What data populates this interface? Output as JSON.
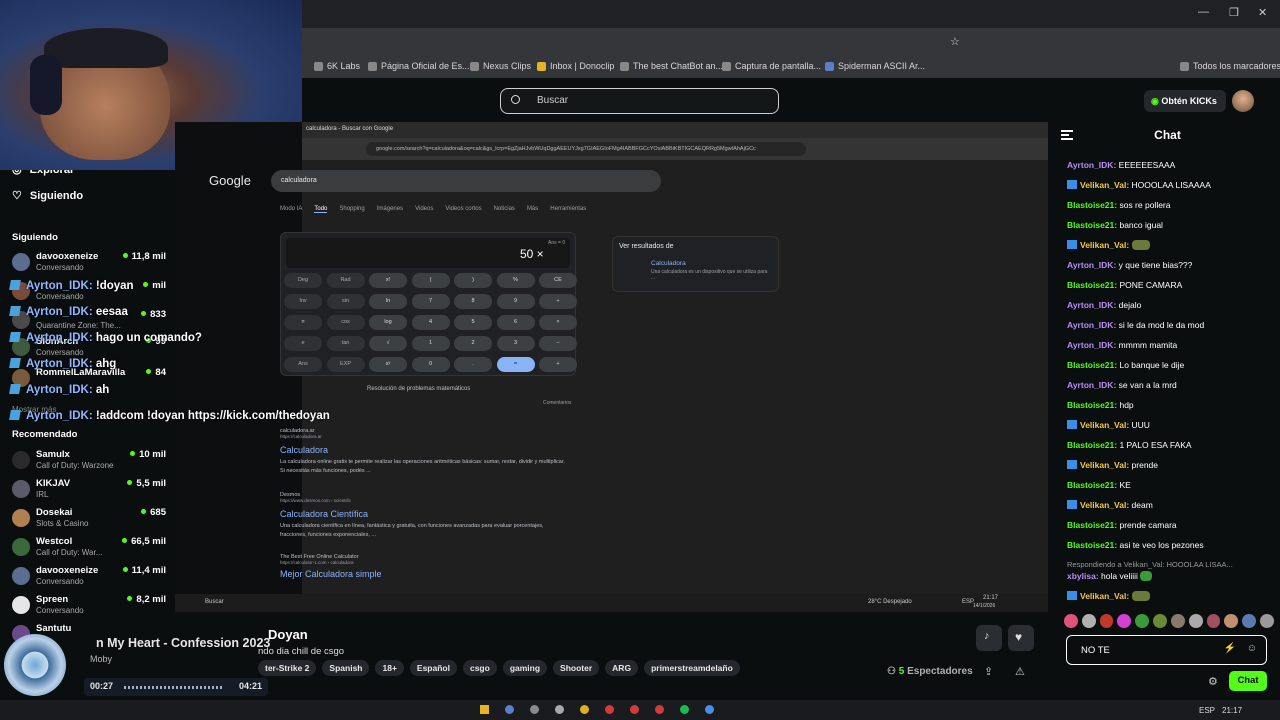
{
  "browser": {
    "bookmarks": [
      "6K Labs",
      "Página Oficial de Es...",
      "Nexus Clips",
      "Inbox | Donoclip",
      "The best ChatBot an...",
      "Captura de pantalla...",
      "Spiderman ASCII Ar..."
    ],
    "all_bookmarks": "Todos los marcadores"
  },
  "kick": {
    "search_placeholder": "Buscar",
    "get_kicks_prefix": "Obtén",
    "get_kicks_suffix": "KICKs"
  },
  "sidebar": {
    "explore": "Explorar",
    "following": "Siguiendo",
    "following_section": "Siguiendo",
    "followed": [
      {
        "name": "davooxeneize",
        "sub": "Conversando",
        "viewers": "11,8 mil",
        "color": "#5b6e8f"
      },
      {
        "name": "",
        "sub": "Conversando",
        "viewers": "mil",
        "color": "#7a4a3a"
      },
      {
        "name": "",
        "sub": "Quarantine Zone: The...",
        "viewers": "833",
        "color": "#4a4a4a"
      },
      {
        "name": "SlonArch",
        "sub": "Conversando",
        "viewers": "99",
        "color": "#3f5a3f"
      },
      {
        "name": "RommelLaMaravilla",
        "sub": "",
        "viewers": "84",
        "color": "#7a5a3a"
      }
    ],
    "show_more": "Mostrar más",
    "recommended_section": "Recomendado",
    "recommended": [
      {
        "name": "Samulx",
        "sub": "Call of Duty: Warzone",
        "viewers": "10 mil",
        "color": "#2a2a2a"
      },
      {
        "name": "KIKJAV",
        "sub": "IRL",
        "viewers": "5,5 mil",
        "color": "#5a5a6a"
      },
      {
        "name": "Dosekai",
        "sub": "Slots & Casino",
        "viewers": "685",
        "color": "#b08050"
      },
      {
        "name": "Westcol",
        "sub": "Call of Duty: War...",
        "viewers": "66,5 mil",
        "color": "#3a6a3a"
      },
      {
        "name": "davooxeneize",
        "sub": "Conversando",
        "viewers": "11,4 mil",
        "color": "#5b6e8f"
      },
      {
        "name": "Spreen",
        "sub": "Conversando",
        "viewers": "8,2 mil",
        "color": "#e6e6e6"
      },
      {
        "name": "Santutu",
        "sub": "",
        "viewers": "",
        "color": "#6a4a8a"
      }
    ]
  },
  "overlay_chat": [
    {
      "user": "Ayrton_IDK:",
      "text": "!doyan"
    },
    {
      "user": "Ayrton_IDK:",
      "text": "eesaa"
    },
    {
      "user": "Ayrton_IDK:",
      "text": "hago un comando?"
    },
    {
      "user": "Ayrton_IDK:",
      "text": "ahg"
    },
    {
      "user": "Ayrton_IDK:",
      "text": "ah"
    },
    {
      "user": "Ayrton_IDK:",
      "text": "!addcom !doyan https://kick.com/thedoyan"
    }
  ],
  "inner_browser": {
    "tab": "calculadora - Buscar con Google",
    "url": "google.com/search?q=calculadora&oq=calc&gs_lcrp=EgZjaHJvbWUqDggAEEUYJxg7GIAEGIoFMg4IABBFGCcYOxiABBiKBTIGCAEQRRg5MgwIAhAjGCc",
    "logo": "Google",
    "query": "calculadora",
    "tabs": [
      "Modo IA",
      "Todo",
      "Shopping",
      "Imágenes",
      "Videos",
      "Videos cortos",
      "Noticias",
      "Más",
      "Herramientas"
    ],
    "calc_value": "50 ×",
    "calc_ans": "Ans = 0",
    "keys": [
      [
        "Deg",
        "Rad",
        "x!",
        "(",
        ")",
        "%",
        "CE"
      ],
      [
        "Inv",
        "sin",
        "ln",
        "7",
        "8",
        "9",
        "÷"
      ],
      [
        "π",
        "cos",
        "log",
        "4",
        "5",
        "6",
        "×"
      ],
      [
        "e",
        "tan",
        "√",
        "1",
        "2",
        "3",
        "−"
      ],
      [
        "Ans",
        "EXP",
        "xʸ",
        "0",
        ".",
        "=",
        "+"
      ]
    ],
    "math_help": "Resolución de problemas matemáticos",
    "comments": "Comentarios",
    "panel_heading": "Ver resultados de",
    "panel_item": "Calculadora",
    "panel_desc": "Una calculadora es un dispositivo que se utiliza para ...",
    "results": [
      {
        "site": "calculadora.ar",
        "url": "https://calculadora.ar",
        "title": "Calculadora",
        "desc": "La calculadora online gratis te permite realizar las operaciones aritméticas básicas: sumar, restar, dividir y multiplicar. Si necesitás más funciones, podés ..."
      },
      {
        "site": "Desmos",
        "url": "https://www.desmos.com › scientific",
        "title": "Calculadora Científica",
        "desc": "Una calculadora científica en línea, fantástica y gratuita, con funciones avanzadas para evaluar porcentajes, fracciones, funciones exponenciales, ..."
      },
      {
        "site": "The Best Free Online Calculator",
        "url": "https://calculator-1.com › calculadora",
        "title": "Mejor Calculadora simple",
        "desc": ""
      }
    ],
    "taskbar_search": "Buscar",
    "weather": "28°C Despejado",
    "time": "21:17",
    "date": "14/1/2026",
    "lang": "ESP"
  },
  "music": {
    "title": "n My Heart - Confession 2023",
    "artist": "Moby",
    "elapsed": "00:27",
    "total": "04:21"
  },
  "stream_info": {
    "name": "Doyan",
    "title": "ndo dia chill de csgo",
    "tags": [
      "ter-Strike 2",
      "Spanish",
      "18+",
      "Español",
      "csgo",
      "gaming",
      "Shooter",
      "ARG",
      "primerstreamdelaño"
    ],
    "viewers_count": "5",
    "viewers_label": "Espectadores"
  },
  "chat": {
    "title": "Chat",
    "messages": [
      {
        "user": "Ayrton_IDK:",
        "text": "EEEEEESAAA",
        "color": "#b88cf5",
        "badge": false
      },
      {
        "user": "Velikan_Val:",
        "text": "HOOOLAA LISAAAA",
        "color": "#f2c94c",
        "badge": true
      },
      {
        "user": "Blastoise21:",
        "text": "sos re pollera",
        "color": "#53fc18",
        "badge": false
      },
      {
        "user": "Blastoise21:",
        "text": "banco igual",
        "color": "#53fc18",
        "badge": false
      },
      {
        "user": "Velikan_Val:",
        "text": "",
        "color": "#f2c94c",
        "badge": true,
        "emote": true
      },
      {
        "user": "Ayrton_IDK:",
        "text": "y que tiene bias???",
        "color": "#b88cf5",
        "badge": false
      },
      {
        "user": "Blastoise21:",
        "text": "PONE CAMARA",
        "color": "#53fc18",
        "badge": false
      },
      {
        "user": "Ayrton_IDK:",
        "text": "dejalo",
        "color": "#b88cf5",
        "badge": false
      },
      {
        "user": "Ayrton_IDK:",
        "text": "si le da mod le da mod",
        "color": "#b88cf5",
        "badge": false
      },
      {
        "user": "Ayrton_IDK:",
        "text": "mmmm mamita",
        "color": "#b88cf5",
        "badge": false
      },
      {
        "user": "Blastoise21:",
        "text": "Lo banque le dije",
        "color": "#53fc18",
        "badge": false
      },
      {
        "user": "Ayrton_IDK:",
        "text": "se van a la mrd",
        "color": "#b88cf5",
        "badge": false
      },
      {
        "user": "Blastoise21:",
        "text": "hdp",
        "color": "#53fc18",
        "badge": false
      },
      {
        "user": "Velikan_Val:",
        "text": "UUU",
        "color": "#f2c94c",
        "badge": true
      },
      {
        "user": "Blastoise21:",
        "text": "1 PALO ESA FAKA",
        "color": "#53fc18",
        "badge": false
      },
      {
        "user": "Velikan_Val:",
        "text": "prende",
        "color": "#f2c94c",
        "badge": true
      },
      {
        "user": "Blastoise21:",
        "text": "KE",
        "color": "#53fc18",
        "badge": false
      },
      {
        "user": "Velikan_Val:",
        "text": "deam",
        "color": "#f2c94c",
        "badge": true
      },
      {
        "user": "Blastoise21:",
        "text": "prende camara",
        "color": "#53fc18",
        "badge": false
      },
      {
        "user": "Blastoise21:",
        "text": "asi te veo los pezones",
        "color": "#53fc18",
        "badge": false
      }
    ],
    "reply_to": "Respondiendo a Velikan_Val: HOOOLAA LISAA...",
    "reply_user": "xbylisa:",
    "reply_text": "hola veliiii",
    "last_user": "Velikan_Val:",
    "input_value": "NO TE",
    "send_label": "Chat"
  },
  "colors": {
    "accent": "#53fc18",
    "background": "#0b0e0f"
  }
}
